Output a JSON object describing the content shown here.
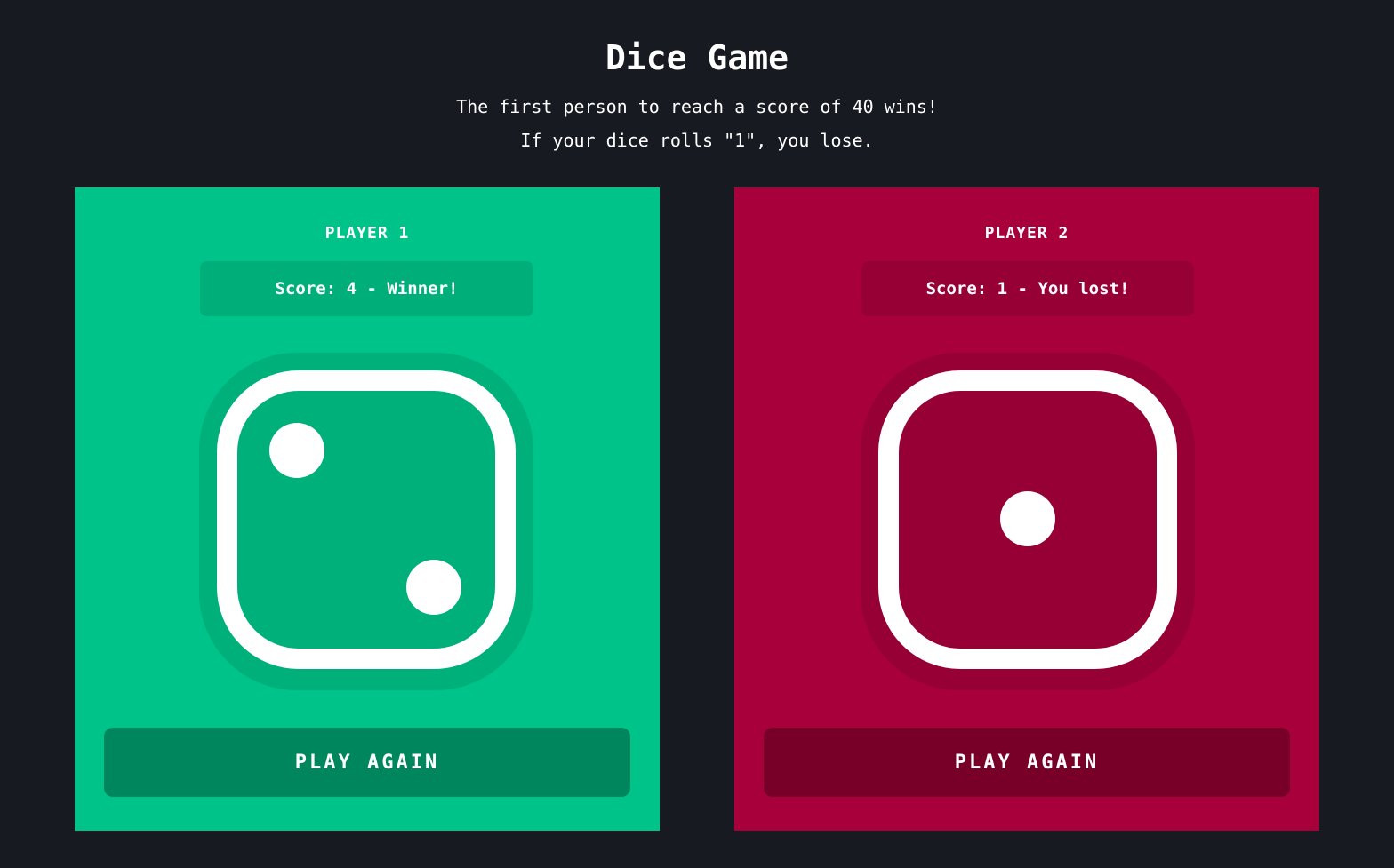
{
  "header": {
    "title": "Dice Game",
    "rule_line_1": "The first person to reach a score of 40 wins!",
    "rule_line_2": "If your dice rolls \"1\", you lose."
  },
  "players": [
    {
      "label": "PLAYER 1",
      "score_text": "Score: 4 - Winner!",
      "dice_value": 2,
      "dice_icon": "dice-two-icon",
      "status": "winner",
      "button_label": "PLAY AGAIN",
      "colors": {
        "panel": "#00c389",
        "score_box": "#00ae7a",
        "dice_bg": "#00b07b",
        "button": "#00865d"
      }
    },
    {
      "label": "PLAYER 2",
      "score_text": "Score: 1 - You lost!",
      "dice_value": 1,
      "dice_icon": "dice-one-icon",
      "status": "lost",
      "button_label": "PLAY AGAIN",
      "colors": {
        "panel": "#a8003b",
        "score_box": "#970035",
        "dice_bg": "#970035",
        "button": "#780028"
      }
    }
  ],
  "colors": {
    "background": "#181a22",
    "text": "#ffffff"
  }
}
